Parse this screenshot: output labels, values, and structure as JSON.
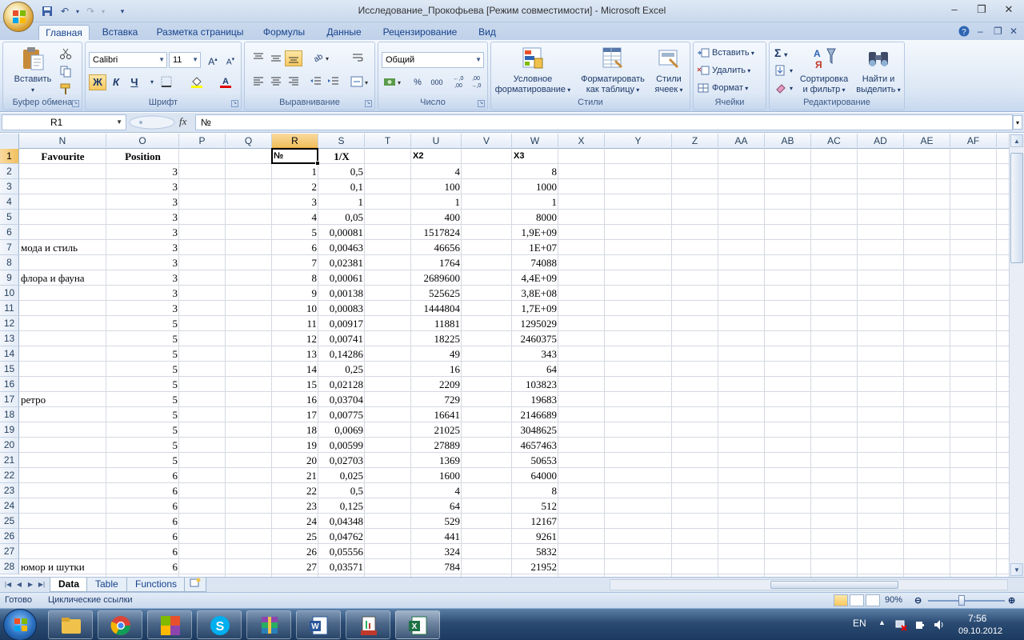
{
  "window": {
    "title": "Исследование_Прокофьева  [Режим совместимости] - Microsoft Excel"
  },
  "ribbon_tabs": [
    "Главная",
    "Вставка",
    "Разметка страницы",
    "Формулы",
    "Данные",
    "Рецензирование",
    "Вид"
  ],
  "ribbon": {
    "clipboard": {
      "paste": "Вставить",
      "label": "Буфер обмена"
    },
    "font": {
      "name": "Calibri",
      "size": "11",
      "bold": "Ж",
      "italic": "К",
      "underline": "Ч",
      "label": "Шрифт"
    },
    "alignment": {
      "label": "Выравнивание"
    },
    "number": {
      "format": "Общий",
      "label": "Число"
    },
    "styles": {
      "conditional_1": "Условное",
      "conditional_2": "форматирование",
      "table_1": "Форматировать",
      "table_2": "как таблицу",
      "cell_1": "Стили",
      "cell_2": "ячеек",
      "label": "Стили"
    },
    "cells": {
      "insert": "Вставить",
      "delete": "Удалить",
      "format": "Формат",
      "label": "Ячейки"
    },
    "editing": {
      "sort_1": "Сортировка",
      "sort_2": "и фильтр",
      "find_1": "Найти и",
      "find_2": "выделить",
      "label": "Редактирование"
    }
  },
  "formula_bar": {
    "name_box": "R1",
    "fx": "fx",
    "value": "№"
  },
  "columns": [
    "N",
    "O",
    "P",
    "Q",
    "R",
    "S",
    "T",
    "U",
    "V",
    "W",
    "X",
    "Y",
    "Z",
    "AA",
    "AB",
    "AC",
    "AD",
    "AE",
    "AF"
  ],
  "headers": {
    "N": "Favourite",
    "O": "Position",
    "R": "№",
    "S": "1/X",
    "U": "X2",
    "W": "X3"
  },
  "rows": [
    {
      "row": "2",
      "N": "",
      "O": "3",
      "R": "1",
      "S": "0,5",
      "U": "4",
      "W": "8"
    },
    {
      "row": "3",
      "N": "",
      "O": "3",
      "R": "2",
      "S": "0,1",
      "U": "100",
      "W": "1000"
    },
    {
      "row": "4",
      "N": "",
      "O": "3",
      "R": "3",
      "S": "1",
      "U": "1",
      "W": "1"
    },
    {
      "row": "5",
      "N": "",
      "O": "3",
      "R": "4",
      "S": "0,05",
      "U": "400",
      "W": "8000"
    },
    {
      "row": "6",
      "N": "",
      "O": "3",
      "R": "5",
      "S": "0,00081",
      "U": "1517824",
      "W": "1,9E+09"
    },
    {
      "row": "7",
      "N": "мода и стиль",
      "O": "3",
      "R": "6",
      "S": "0,00463",
      "U": "46656",
      "W": "1E+07"
    },
    {
      "row": "8",
      "N": "",
      "O": "3",
      "R": "7",
      "S": "0,02381",
      "U": "1764",
      "W": "74088"
    },
    {
      "row": "9",
      "N": "флора и фауна",
      "O": "3",
      "R": "8",
      "S": "0,00061",
      "U": "2689600",
      "W": "4,4E+09"
    },
    {
      "row": "10",
      "N": "",
      "O": "3",
      "R": "9",
      "S": "0,00138",
      "U": "525625",
      "W": "3,8E+08"
    },
    {
      "row": "11",
      "N": "",
      "O": "3",
      "R": "10",
      "S": "0,00083",
      "U": "1444804",
      "W": "1,7E+09"
    },
    {
      "row": "12",
      "N": "",
      "O": "5",
      "R": "11",
      "S": "0,00917",
      "U": "11881",
      "W": "1295029"
    },
    {
      "row": "13",
      "N": "",
      "O": "5",
      "R": "12",
      "S": "0,00741",
      "U": "18225",
      "W": "2460375"
    },
    {
      "row": "14",
      "N": "",
      "O": "5",
      "R": "13",
      "S": "0,14286",
      "U": "49",
      "W": "343"
    },
    {
      "row": "15",
      "N": "",
      "O": "5",
      "R": "14",
      "S": "0,25",
      "U": "16",
      "W": "64"
    },
    {
      "row": "16",
      "N": "",
      "O": "5",
      "R": "15",
      "S": "0,02128",
      "U": "2209",
      "W": "103823"
    },
    {
      "row": "17",
      "N": "ретро",
      "O": "5",
      "R": "16",
      "S": "0,03704",
      "U": "729",
      "W": "19683"
    },
    {
      "row": "18",
      "N": "",
      "O": "5",
      "R": "17",
      "S": "0,00775",
      "U": "16641",
      "W": "2146689"
    },
    {
      "row": "19",
      "N": "",
      "O": "5",
      "R": "18",
      "S": "0,0069",
      "U": "21025",
      "W": "3048625"
    },
    {
      "row": "20",
      "N": "",
      "O": "5",
      "R": "19",
      "S": "0,00599",
      "U": "27889",
      "W": "4657463"
    },
    {
      "row": "21",
      "N": "",
      "O": "5",
      "R": "20",
      "S": "0,02703",
      "U": "1369",
      "W": "50653"
    },
    {
      "row": "22",
      "N": "",
      "O": "6",
      "R": "21",
      "S": "0,025",
      "U": "1600",
      "W": "64000"
    },
    {
      "row": "23",
      "N": "",
      "O": "6",
      "R": "22",
      "S": "0,5",
      "U": "4",
      "W": "8"
    },
    {
      "row": "24",
      "N": "",
      "O": "6",
      "R": "23",
      "S": "0,125",
      "U": "64",
      "W": "512"
    },
    {
      "row": "25",
      "N": "",
      "O": "6",
      "R": "24",
      "S": "0,04348",
      "U": "529",
      "W": "12167"
    },
    {
      "row": "26",
      "N": "",
      "O": "6",
      "R": "25",
      "S": "0,04762",
      "U": "441",
      "W": "9261"
    },
    {
      "row": "27",
      "N": "",
      "O": "6",
      "R": "26",
      "S": "0,05556",
      "U": "324",
      "W": "5832"
    },
    {
      "row": "28",
      "N": "юмор и шутки",
      "O": "6",
      "R": "27",
      "S": "0,03571",
      "U": "784",
      "W": "21952"
    }
  ],
  "sheet_tabs": [
    "Data",
    "Table",
    "Functions"
  ],
  "status": {
    "ready": "Готово",
    "circular": "Циклические ссылки",
    "zoom": "90%"
  },
  "taskbar": {
    "lang": "EN",
    "time": "7:56",
    "date": "09.10.2012"
  },
  "colors": {
    "accent": "#15428b",
    "selection": "#f1c05c",
    "ribbon": "#dce7f5"
  }
}
